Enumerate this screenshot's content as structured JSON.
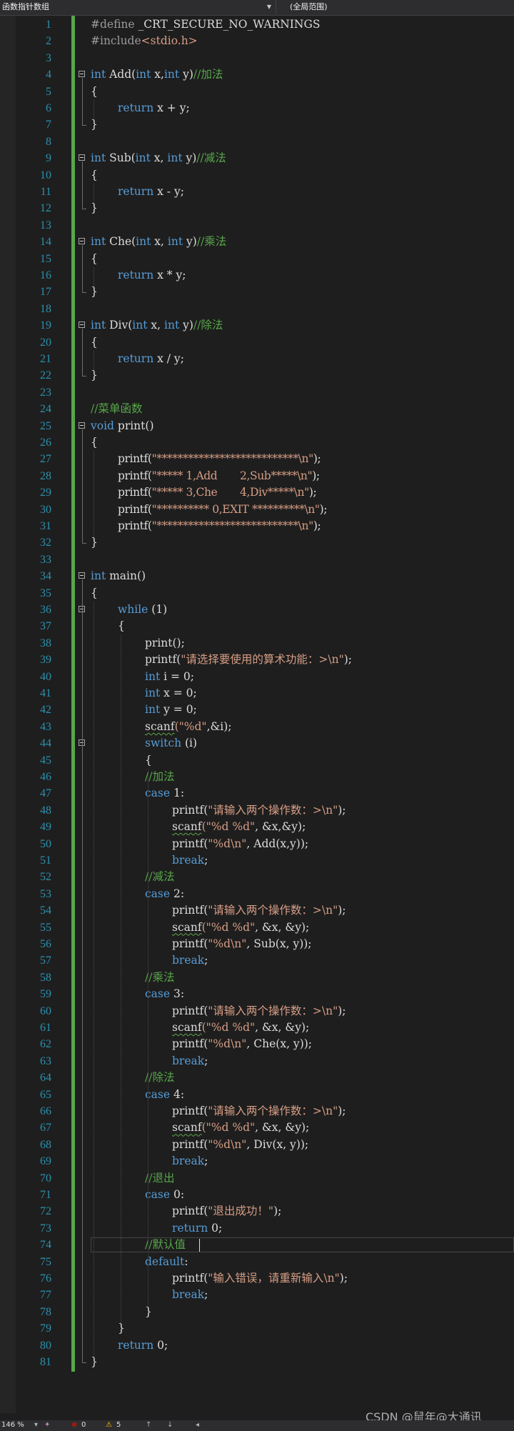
{
  "nav": {
    "scope_label": "函数指针数组",
    "member_label": "(全局范围)"
  },
  "status": {
    "zoom": "146 %",
    "errors": "0",
    "warnings": "5"
  },
  "watermark": "CSDN @鼠年@大通讯",
  "editor": {
    "current_line": 74,
    "lines": [
      {
        "n": 1,
        "indent": 0,
        "tokens": [
          [
            "pp",
            "#define "
          ],
          [
            "t",
            "_CRT_SECURE_NO_WARNINGS"
          ]
        ]
      },
      {
        "n": 2,
        "indent": 0,
        "tokens": [
          [
            "pp",
            "#include"
          ],
          [
            "st",
            "<stdio.h>"
          ]
        ]
      },
      {
        "n": 3,
        "indent": 0,
        "tokens": []
      },
      {
        "n": 4,
        "indent": 0,
        "fold": true,
        "tokens": [
          [
            "kw",
            "int"
          ],
          [
            "t",
            " Add("
          ],
          [
            "kw",
            "int"
          ],
          [
            "t",
            " x,"
          ],
          [
            "kw",
            "int"
          ],
          [
            "t",
            " y)"
          ],
          [
            "cm",
            "//加法"
          ]
        ]
      },
      {
        "n": 5,
        "indent": 0,
        "tokens": [
          [
            "t",
            "{"
          ]
        ]
      },
      {
        "n": 6,
        "indent": 1,
        "tokens": [
          [
            "kw",
            "return"
          ],
          [
            "t",
            " x + y;"
          ]
        ]
      },
      {
        "n": 7,
        "indent": 0,
        "tokens": [
          [
            "t",
            "}"
          ]
        ]
      },
      {
        "n": 8,
        "indent": 0,
        "tokens": []
      },
      {
        "n": 9,
        "indent": 0,
        "fold": true,
        "tokens": [
          [
            "kw",
            "int"
          ],
          [
            "t",
            " Sub("
          ],
          [
            "kw",
            "int"
          ],
          [
            "t",
            " x, "
          ],
          [
            "kw",
            "int"
          ],
          [
            "t",
            " y)"
          ],
          [
            "cm",
            "//减法"
          ]
        ]
      },
      {
        "n": 10,
        "indent": 0,
        "tokens": [
          [
            "t",
            "{"
          ]
        ]
      },
      {
        "n": 11,
        "indent": 1,
        "tokens": [
          [
            "kw",
            "return"
          ],
          [
            "t",
            " x - y;"
          ]
        ]
      },
      {
        "n": 12,
        "indent": 0,
        "tokens": [
          [
            "t",
            "}"
          ]
        ]
      },
      {
        "n": 13,
        "indent": 0,
        "tokens": []
      },
      {
        "n": 14,
        "indent": 0,
        "fold": true,
        "tokens": [
          [
            "kw",
            "int"
          ],
          [
            "t",
            " Che("
          ],
          [
            "kw",
            "int"
          ],
          [
            "t",
            " x, "
          ],
          [
            "kw",
            "int"
          ],
          [
            "t",
            " y)"
          ],
          [
            "cm",
            "//乘法"
          ]
        ]
      },
      {
        "n": 15,
        "indent": 0,
        "tokens": [
          [
            "t",
            "{"
          ]
        ]
      },
      {
        "n": 16,
        "indent": 1,
        "tokens": [
          [
            "kw",
            "return"
          ],
          [
            "t",
            " x * y;"
          ]
        ]
      },
      {
        "n": 17,
        "indent": 0,
        "tokens": [
          [
            "t",
            "}"
          ]
        ]
      },
      {
        "n": 18,
        "indent": 0,
        "tokens": []
      },
      {
        "n": 19,
        "indent": 0,
        "fold": true,
        "tokens": [
          [
            "kw",
            "int"
          ],
          [
            "t",
            " Div("
          ],
          [
            "kw",
            "int"
          ],
          [
            "t",
            " x, "
          ],
          [
            "kw",
            "int"
          ],
          [
            "t",
            " y)"
          ],
          [
            "cm",
            "//除法"
          ]
        ]
      },
      {
        "n": 20,
        "indent": 0,
        "tokens": [
          [
            "t",
            "{"
          ]
        ]
      },
      {
        "n": 21,
        "indent": 1,
        "tokens": [
          [
            "kw",
            "return"
          ],
          [
            "t",
            " x / y;"
          ]
        ]
      },
      {
        "n": 22,
        "indent": 0,
        "tokens": [
          [
            "t",
            "}"
          ]
        ]
      },
      {
        "n": 23,
        "indent": 0,
        "tokens": []
      },
      {
        "n": 24,
        "indent": 0,
        "tokens": [
          [
            "cm",
            "//菜单函数"
          ]
        ]
      },
      {
        "n": 25,
        "indent": 0,
        "fold": true,
        "tokens": [
          [
            "kw",
            "void"
          ],
          [
            "t",
            " print()"
          ]
        ]
      },
      {
        "n": 26,
        "indent": 0,
        "tokens": [
          [
            "t",
            "{"
          ]
        ]
      },
      {
        "n": 27,
        "indent": 1,
        "tight": true,
        "tokens": [
          [
            "t",
            "printf("
          ],
          [
            "st",
            "\"***************************\\n\""
          ],
          [
            "t",
            ");"
          ]
        ]
      },
      {
        "n": 28,
        "indent": 1,
        "tight": true,
        "tokens": [
          [
            "t",
            "printf("
          ],
          [
            "st",
            "\"***** 1,Add       2,Sub*****\\n\""
          ],
          [
            "t",
            ");"
          ]
        ]
      },
      {
        "n": 29,
        "indent": 1,
        "tight": true,
        "tokens": [
          [
            "t",
            "printf("
          ],
          [
            "st",
            "\"***** 3,Che       4,Div*****\\n\""
          ],
          [
            "t",
            ");"
          ]
        ]
      },
      {
        "n": 30,
        "indent": 1,
        "tight": true,
        "tokens": [
          [
            "t",
            "printf("
          ],
          [
            "st",
            "\"********** 0,EXIT **********\\n\""
          ],
          [
            "t",
            ");"
          ]
        ]
      },
      {
        "n": 31,
        "indent": 1,
        "tight": true,
        "tokens": [
          [
            "t",
            "printf("
          ],
          [
            "st",
            "\"***************************\\n\""
          ],
          [
            "t",
            ");"
          ]
        ]
      },
      {
        "n": 32,
        "indent": 0,
        "tokens": [
          [
            "t",
            "}"
          ]
        ]
      },
      {
        "n": 33,
        "indent": 0,
        "tokens": []
      },
      {
        "n": 34,
        "indent": 0,
        "fold": true,
        "tokens": [
          [
            "kw",
            "int"
          ],
          [
            "t",
            " main()"
          ]
        ]
      },
      {
        "n": 35,
        "indent": 0,
        "tokens": [
          [
            "t",
            "{"
          ]
        ]
      },
      {
        "n": 36,
        "indent": 1,
        "fold": true,
        "tokens": [
          [
            "kw",
            "while"
          ],
          [
            "t",
            " (1)"
          ]
        ]
      },
      {
        "n": 37,
        "indent": 1,
        "tokens": [
          [
            "t",
            "{"
          ]
        ]
      },
      {
        "n": 38,
        "indent": 2,
        "tokens": [
          [
            "t",
            "print();"
          ]
        ]
      },
      {
        "n": 39,
        "indent": 2,
        "tokens": [
          [
            "t",
            "printf("
          ],
          [
            "st",
            "\"请选择要使用的算术功能：>\\n\""
          ],
          [
            "t",
            ");"
          ]
        ]
      },
      {
        "n": 40,
        "indent": 2,
        "tokens": [
          [
            "kw",
            "int"
          ],
          [
            "t",
            " i = 0;"
          ]
        ]
      },
      {
        "n": 41,
        "indent": 2,
        "tokens": [
          [
            "kw",
            "int"
          ],
          [
            "t",
            " x = 0;"
          ]
        ]
      },
      {
        "n": 42,
        "indent": 2,
        "tokens": [
          [
            "kw",
            "int"
          ],
          [
            "t",
            " y = 0;"
          ]
        ]
      },
      {
        "n": 43,
        "indent": 2,
        "tokens": [
          [
            "sq",
            "scanf"
          ],
          [
            "st",
            "(\"%d\""
          ],
          [
            "t",
            ",&i);"
          ]
        ]
      },
      {
        "n": 44,
        "indent": 2,
        "fold": true,
        "tokens": [
          [
            "kw",
            "switch"
          ],
          [
            "t",
            " (i)"
          ]
        ]
      },
      {
        "n": 45,
        "indent": 2,
        "tokens": [
          [
            "t",
            "{"
          ]
        ]
      },
      {
        "n": 46,
        "indent": 2,
        "tokens": [
          [
            "cm",
            "//加法"
          ]
        ]
      },
      {
        "n": 47,
        "indent": 2,
        "tokens": [
          [
            "kw",
            "case"
          ],
          [
            "t",
            " 1:"
          ]
        ]
      },
      {
        "n": 48,
        "indent": 3,
        "tokens": [
          [
            "t",
            "printf("
          ],
          [
            "st",
            "\"请输入两个操作数：>\\n\""
          ],
          [
            "t",
            ");"
          ]
        ]
      },
      {
        "n": 49,
        "indent": 3,
        "tokens": [
          [
            "sq",
            "scanf"
          ],
          [
            "st",
            "(\"%d %d\""
          ],
          [
            "t",
            ", &x,&y);"
          ]
        ]
      },
      {
        "n": 50,
        "indent": 3,
        "tokens": [
          [
            "t",
            "printf("
          ],
          [
            "st",
            "\"%d\\n\""
          ],
          [
            "t",
            ", Add(x,y));"
          ]
        ]
      },
      {
        "n": 51,
        "indent": 3,
        "tokens": [
          [
            "kw",
            "break"
          ],
          [
            "t",
            ";"
          ]
        ]
      },
      {
        "n": 52,
        "indent": 2,
        "tokens": [
          [
            "cm",
            "//减法"
          ]
        ]
      },
      {
        "n": 53,
        "indent": 2,
        "tokens": [
          [
            "kw",
            "case"
          ],
          [
            "t",
            " 2:"
          ]
        ]
      },
      {
        "n": 54,
        "indent": 3,
        "tokens": [
          [
            "t",
            "printf("
          ],
          [
            "st",
            "\"请输入两个操作数：>\\n\""
          ],
          [
            "t",
            ");"
          ]
        ]
      },
      {
        "n": 55,
        "indent": 3,
        "tokens": [
          [
            "sq",
            "scanf"
          ],
          [
            "st",
            "(\"%d %d\""
          ],
          [
            "t",
            ", &x, &y);"
          ]
        ]
      },
      {
        "n": 56,
        "indent": 3,
        "tokens": [
          [
            "t",
            "printf("
          ],
          [
            "st",
            "\"%d\\n\""
          ],
          [
            "t",
            ", Sub(x, y));"
          ]
        ]
      },
      {
        "n": 57,
        "indent": 3,
        "tokens": [
          [
            "kw",
            "break"
          ],
          [
            "t",
            ";"
          ]
        ]
      },
      {
        "n": 58,
        "indent": 2,
        "tokens": [
          [
            "cm",
            "//乘法"
          ]
        ]
      },
      {
        "n": 59,
        "indent": 2,
        "tokens": [
          [
            "kw",
            "case"
          ],
          [
            "t",
            " 3:"
          ]
        ]
      },
      {
        "n": 60,
        "indent": 3,
        "tokens": [
          [
            "t",
            "printf("
          ],
          [
            "st",
            "\"请输入两个操作数：>\\n\""
          ],
          [
            "t",
            ");"
          ]
        ]
      },
      {
        "n": 61,
        "indent": 3,
        "tokens": [
          [
            "sq",
            "scanf"
          ],
          [
            "st",
            "(\"%d %d\""
          ],
          [
            "t",
            ", &x, &y);"
          ]
        ]
      },
      {
        "n": 62,
        "indent": 3,
        "tokens": [
          [
            "t",
            "printf("
          ],
          [
            "st",
            "\"%d\\n\""
          ],
          [
            "t",
            ", Che(x, y));"
          ]
        ]
      },
      {
        "n": 63,
        "indent": 3,
        "tokens": [
          [
            "kw",
            "break"
          ],
          [
            "t",
            ";"
          ]
        ]
      },
      {
        "n": 64,
        "indent": 2,
        "tokens": [
          [
            "cm",
            "//除法"
          ]
        ]
      },
      {
        "n": 65,
        "indent": 2,
        "tokens": [
          [
            "kw",
            "case"
          ],
          [
            "t",
            " 4:"
          ]
        ]
      },
      {
        "n": 66,
        "indent": 3,
        "tokens": [
          [
            "t",
            "printf("
          ],
          [
            "st",
            "\"请输入两个操作数：>\\n\""
          ],
          [
            "t",
            ");"
          ]
        ]
      },
      {
        "n": 67,
        "indent": 3,
        "tokens": [
          [
            "sq",
            "scanf"
          ],
          [
            "st",
            "(\"%d %d\""
          ],
          [
            "t",
            ", &x, &y);"
          ]
        ]
      },
      {
        "n": 68,
        "indent": 3,
        "tokens": [
          [
            "t",
            "printf("
          ],
          [
            "st",
            "\"%d\\n\""
          ],
          [
            "t",
            ", Div(x, y));"
          ]
        ]
      },
      {
        "n": 69,
        "indent": 3,
        "tokens": [
          [
            "kw",
            "break"
          ],
          [
            "t",
            ";"
          ]
        ]
      },
      {
        "n": 70,
        "indent": 2,
        "tokens": [
          [
            "cm",
            "//退出"
          ]
        ]
      },
      {
        "n": 71,
        "indent": 2,
        "tokens": [
          [
            "kw",
            "case"
          ],
          [
            "t",
            " 0:"
          ]
        ]
      },
      {
        "n": 72,
        "indent": 3,
        "tokens": [
          [
            "t",
            "printf("
          ],
          [
            "st",
            "\"退出成功！\""
          ],
          [
            "t",
            ");"
          ]
        ]
      },
      {
        "n": 73,
        "indent": 3,
        "tokens": [
          [
            "kw",
            "return"
          ],
          [
            "t",
            " 0;"
          ]
        ]
      },
      {
        "n": 74,
        "indent": 2,
        "tokens": [
          [
            "cm",
            "//默认值"
          ]
        ]
      },
      {
        "n": 75,
        "indent": 2,
        "tokens": [
          [
            "kw",
            "default"
          ],
          [
            "t",
            ":"
          ]
        ]
      },
      {
        "n": 76,
        "indent": 3,
        "tokens": [
          [
            "t",
            "printf("
          ],
          [
            "st",
            "\"输入错误，请重新输入\\n\""
          ],
          [
            "t",
            ");"
          ]
        ]
      },
      {
        "n": 77,
        "indent": 3,
        "tokens": [
          [
            "kw",
            "break"
          ],
          [
            "t",
            ";"
          ]
        ]
      },
      {
        "n": 78,
        "indent": 2,
        "tokens": [
          [
            "t",
            "}"
          ]
        ]
      },
      {
        "n": 79,
        "indent": 1,
        "tokens": [
          [
            "t",
            "}"
          ]
        ]
      },
      {
        "n": 80,
        "indent": 1,
        "tokens": [
          [
            "kw",
            "return"
          ],
          [
            "t",
            " 0;"
          ]
        ]
      },
      {
        "n": 81,
        "indent": 0,
        "tokens": [
          [
            "t",
            "}"
          ]
        ]
      }
    ]
  }
}
